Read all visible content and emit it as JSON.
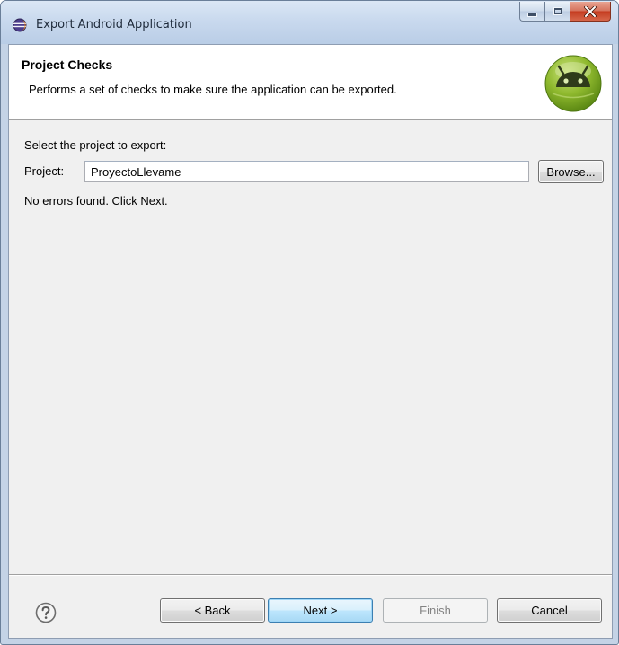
{
  "window": {
    "title": "Export Android Application",
    "icons": {
      "app": "eclipse-icon",
      "minimize": "minimize-icon",
      "maximize": "maximize-icon",
      "close": "close-icon"
    }
  },
  "banner": {
    "title": "Project Checks",
    "description": "Performs a set of checks to make sure the application can be exported.",
    "logo": "android-icon"
  },
  "form": {
    "select_label": "Select the project to export:",
    "project_label": "Project:",
    "project_value": "ProyectoLlevame",
    "browse_label": "Browse...",
    "status_message": "No errors found. Click Next."
  },
  "footer": {
    "help_icon": "help-icon",
    "back_label": "< Back",
    "next_label": "Next >",
    "finish_label": "Finish",
    "cancel_label": "Cancel",
    "finish_enabled": false,
    "default_button": "next"
  },
  "colors": {
    "titlebar": "#c9d9ee",
    "client_background": "#f0f0f0",
    "banner_background": "#ffffff",
    "close_button": "#c43b1f",
    "default_button_border": "#3c7fb1",
    "android_green": "#a4c639"
  }
}
